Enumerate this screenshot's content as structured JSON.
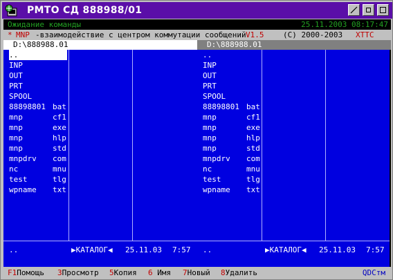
{
  "window": {
    "title": "РМТО СД 888988/01"
  },
  "status": {
    "text": "Ожидание команды",
    "datetime": "25.11.2003 08:17:47"
  },
  "header": {
    "star": "*",
    "name": "MNP",
    "description": "-взаимодействие с центром коммутации сообщений",
    "version": "V1.5",
    "copyright": "(C) 2000-2003",
    "org": "ХТТС"
  },
  "left_panel": {
    "path": "D:\\888988.01",
    "files": [
      {
        "name": "..",
        "ext": ""
      },
      {
        "name": "INP",
        "ext": ""
      },
      {
        "name": "OUT",
        "ext": ""
      },
      {
        "name": "PRT",
        "ext": ""
      },
      {
        "name": "SPOOL",
        "ext": ""
      },
      {
        "name": "88898801",
        "ext": "bat"
      },
      {
        "name": "mnp",
        "ext": "cf1"
      },
      {
        "name": "mnp",
        "ext": "exe"
      },
      {
        "name": "mnp",
        "ext": "hlp"
      },
      {
        "name": "mnp",
        "ext": "std"
      },
      {
        "name": "mnpdrv",
        "ext": "com"
      },
      {
        "name": "nc",
        "ext": "mnu"
      },
      {
        "name": "test",
        "ext": "tlg"
      },
      {
        "name": "wpname",
        "ext": "txt"
      }
    ],
    "footer": {
      "name": "..",
      "type": "▶КАТАЛОГ◀",
      "date": "25.11.03",
      "time": "7:57"
    }
  },
  "right_panel": {
    "path": "D:\\888988.01",
    "files": [
      {
        "name": "..",
        "ext": ""
      },
      {
        "name": "INP",
        "ext": ""
      },
      {
        "name": "OUT",
        "ext": ""
      },
      {
        "name": "PRT",
        "ext": ""
      },
      {
        "name": "SPOOL",
        "ext": ""
      },
      {
        "name": "88898801",
        "ext": "bat"
      },
      {
        "name": "mnp",
        "ext": "cf1"
      },
      {
        "name": "mnp",
        "ext": "exe"
      },
      {
        "name": "mnp",
        "ext": "hlp"
      },
      {
        "name": "mnp",
        "ext": "std"
      },
      {
        "name": "mnpdrv",
        "ext": "com"
      },
      {
        "name": "nc",
        "ext": "mnu"
      },
      {
        "name": "test",
        "ext": "tlg"
      },
      {
        "name": "wpname",
        "ext": "txt"
      }
    ],
    "footer": {
      "name": "..",
      "type": "▶КАТАЛОГ◀",
      "date": "25.11.03",
      "time": "7:57"
    }
  },
  "function_keys": [
    {
      "num": "F1",
      "label": "Помощь"
    },
    {
      "num": "3",
      "label": "Просмотр"
    },
    {
      "num": "5",
      "label": "Копия"
    },
    {
      "num": "6",
      "label": " Имя"
    },
    {
      "num": "7",
      "label": "Новый"
    },
    {
      "num": "8",
      "label": "Удалить"
    }
  ],
  "brand": "QDCтм",
  "colors": {
    "titlebar": "#5a0ea8",
    "panel_background": "#0000e0",
    "status_text": "#22a022",
    "accent_red": "#c00000"
  }
}
